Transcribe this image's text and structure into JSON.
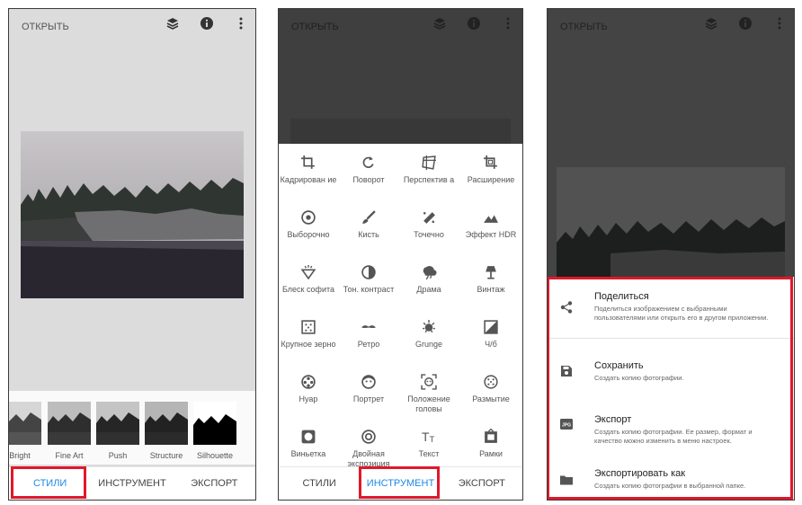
{
  "panel_styles": {
    "header_title": "ОТКРЫТЬ",
    "styles": [
      "Bright",
      "Fine Art",
      "Push",
      "Structure",
      "Silhouette"
    ],
    "nav": [
      "СТИЛИ",
      "ИНСТРУМЕНТ",
      "ЭКСПОРТ"
    ]
  },
  "panel_tools": {
    "header_title": "ОТКРЫТЬ",
    "tools": [
      {
        "label": "Кадрирован ие",
        "icon": "crop-icon"
      },
      {
        "label": "Поворот",
        "icon": "rotate-icon"
      },
      {
        "label": "Перспектив а",
        "icon": "perspective-icon"
      },
      {
        "label": "Расширение",
        "icon": "expand-icon"
      },
      {
        "label": "Выборочно",
        "icon": "selective-icon"
      },
      {
        "label": "Кисть",
        "icon": "brush-icon"
      },
      {
        "label": "Точечно",
        "icon": "healing-icon"
      },
      {
        "label": "Эффект HDR",
        "icon": "hdr-icon"
      },
      {
        "label": "Блеск софита",
        "icon": "glamour-glow-icon"
      },
      {
        "label": "Тон. контраст",
        "icon": "tonal-contrast-icon"
      },
      {
        "label": "Драма",
        "icon": "drama-icon"
      },
      {
        "label": "Винтаж",
        "icon": "vintage-icon"
      },
      {
        "label": "Крупное зерно",
        "icon": "grainy-film-icon"
      },
      {
        "label": "Ретро",
        "icon": "retrolux-icon"
      },
      {
        "label": "Grunge",
        "icon": "grunge-icon"
      },
      {
        "label": "Ч/б",
        "icon": "black-white-icon"
      },
      {
        "label": "Нуар",
        "icon": "noir-icon"
      },
      {
        "label": "Портрет",
        "icon": "portrait-icon"
      },
      {
        "label": "Положение головы",
        "icon": "head-pose-icon"
      },
      {
        "label": "Размытие",
        "icon": "lens-blur-icon"
      },
      {
        "label": "Виньетка",
        "icon": "vignette-icon"
      },
      {
        "label": "Двойная экспозиция",
        "icon": "double-exposure-icon"
      },
      {
        "label": "Текст",
        "icon": "text-icon"
      },
      {
        "label": "Рамки",
        "icon": "frames-icon"
      }
    ],
    "nav": [
      "СТИЛИ",
      "ИНСТРУМЕНТ",
      "ЭКСПОРТ"
    ]
  },
  "panel_export": {
    "header_title": "ОТКРЫТЬ",
    "items": [
      {
        "title": "Поделиться",
        "desc": "Поделиться изображением с выбранными пользователями или открыть его в другом приложении.",
        "icon": "share-icon"
      },
      {
        "title": "Сохранить",
        "desc": "Создать копию фотографии.",
        "icon": "save-icon"
      },
      {
        "title": "Экспорт",
        "desc": "Создать копию фотографии. Ее размер, формат и качество можно изменить в меню настроек.",
        "icon": "jpg-export-icon"
      },
      {
        "title": "Экспортировать как",
        "desc": "Создать копию фотографии в выбранной папке.",
        "icon": "folder-icon"
      }
    ]
  },
  "colors": {
    "accent": "#1e88e5",
    "highlight": "#e0182a"
  }
}
